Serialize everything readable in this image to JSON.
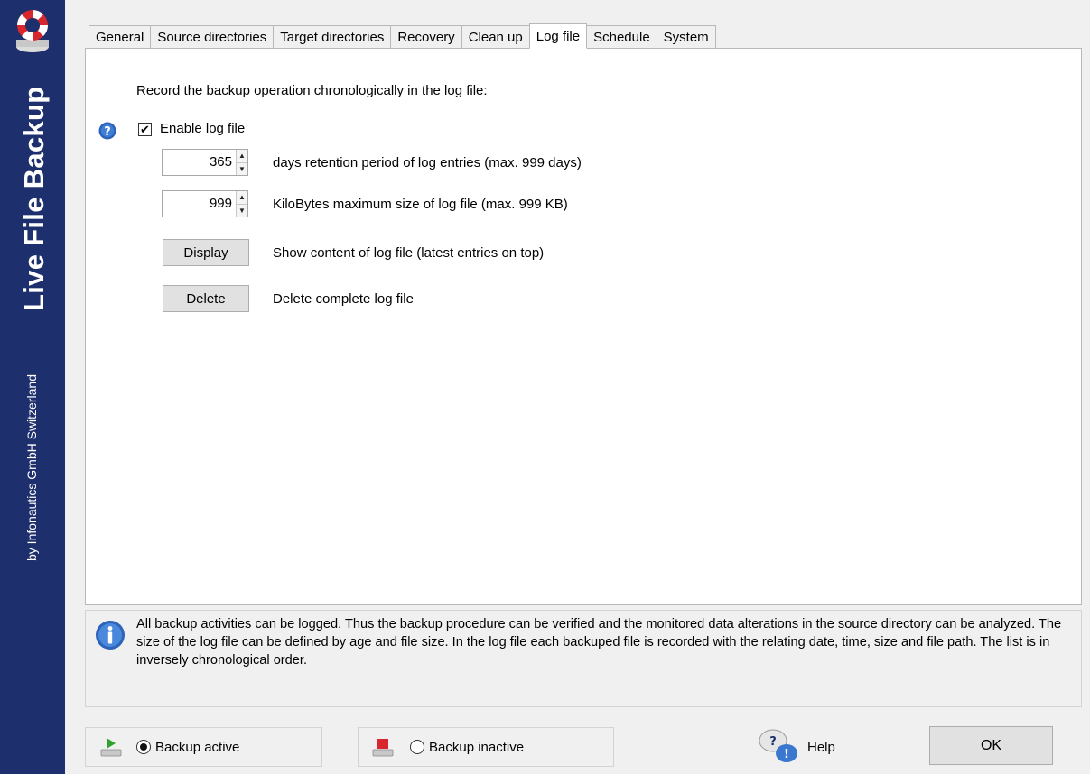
{
  "brand": {
    "title": "Live File Backup",
    "subtitle": "by Infonautics GmbH Switzerland"
  },
  "tabs": [
    {
      "label": "General"
    },
    {
      "label": "Source directories"
    },
    {
      "label": "Target directories"
    },
    {
      "label": "Recovery"
    },
    {
      "label": "Clean up"
    },
    {
      "label": "Log file",
      "active": true
    },
    {
      "label": "Schedule"
    },
    {
      "label": "System"
    }
  ],
  "logfile": {
    "heading": "Record the backup operation chronologically in the log file:",
    "enable_label": "Enable log file",
    "enable_checked": true,
    "retention_value": "365",
    "retention_label": "days retention period of log entries (max. 999 days)",
    "maxsize_value": "999",
    "maxsize_label": "KiloBytes maximum size of log file (max. 999 KB)",
    "display_button": "Display",
    "display_desc": "Show content of log file (latest entries on top)",
    "delete_button": "Delete",
    "delete_desc": "Delete complete log file"
  },
  "info": {
    "text": "All backup activities can be logged. Thus the backup procedure can be verified and the monitored data alterations in the source directory can be analyzed. The size of the log file can be defined by age and file size. In the log file each backuped file is recorded with the relating date, time, size and file path. The list is in inversely chronological order."
  },
  "footer": {
    "backup_active": "Backup active",
    "backup_active_selected": true,
    "backup_inactive": "Backup inactive",
    "help": "Help",
    "ok": "OK"
  },
  "colors": {
    "sidebar": "#1d2f6d",
    "accent_blue": "#2b64b8",
    "active_green": "#2ea32e",
    "inactive_red": "#d8282d"
  },
  "icons": {
    "logo": "lifebuoy-drive-icon",
    "help_marker": "question-circle-icon",
    "info": "info-circle-icon",
    "active": "drive-play-icon",
    "inactive": "drive-stop-icon",
    "help": "speech-bubbles-icon"
  }
}
